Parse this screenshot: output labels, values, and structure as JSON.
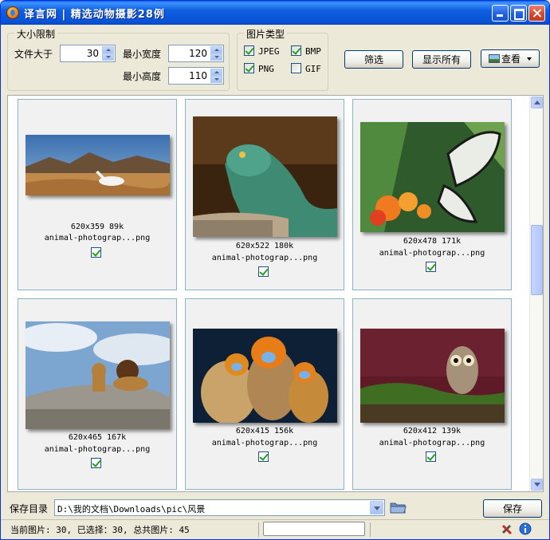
{
  "window": {
    "title": "译言网 | 精选动物摄影28例"
  },
  "size_filter": {
    "legend": "大小限制",
    "file_size_label": "文件大于",
    "file_size_value": "30",
    "min_width_label": "最小宽度",
    "min_width_value": "120",
    "min_height_label": "最小高度",
    "min_height_value": "110"
  },
  "type_filter": {
    "legend": "图片类型",
    "types": [
      {
        "label": "JPEG",
        "checked": true
      },
      {
        "label": "BMP",
        "checked": true
      },
      {
        "label": "PNG",
        "checked": true
      },
      {
        "label": "GIF",
        "checked": false
      }
    ]
  },
  "toolbar": {
    "filter_label": "筛选",
    "show_all_label": "显示所有",
    "view_label": "查看"
  },
  "images": [
    {
      "size": "620x359 89k",
      "name": "animal-photograp...png",
      "checked": true
    },
    {
      "size": "620x522 180k",
      "name": "animal-photograp...png",
      "checked": true
    },
    {
      "size": "620x478 171k",
      "name": "animal-photograp...png",
      "checked": true
    },
    {
      "size": "620x465 167k",
      "name": "animal-photograp...png",
      "checked": true
    },
    {
      "size": "620x415 156k",
      "name": "animal-photograp...png",
      "checked": true
    },
    {
      "size": "620x412 139k",
      "name": "animal-photograp...png",
      "checked": true
    }
  ],
  "save": {
    "label": "保存目录",
    "path": "D:\\我的文档\\Downloads\\pic\\风景",
    "button_label": "保存"
  },
  "status": {
    "text": "当前图片: 30, 已选择：30, 总共图片: 45"
  },
  "icons": [
    "app-icon",
    "minimize-icon",
    "maximize-icon",
    "close-icon",
    "folder-icon",
    "tools-icon",
    "info-icon"
  ]
}
